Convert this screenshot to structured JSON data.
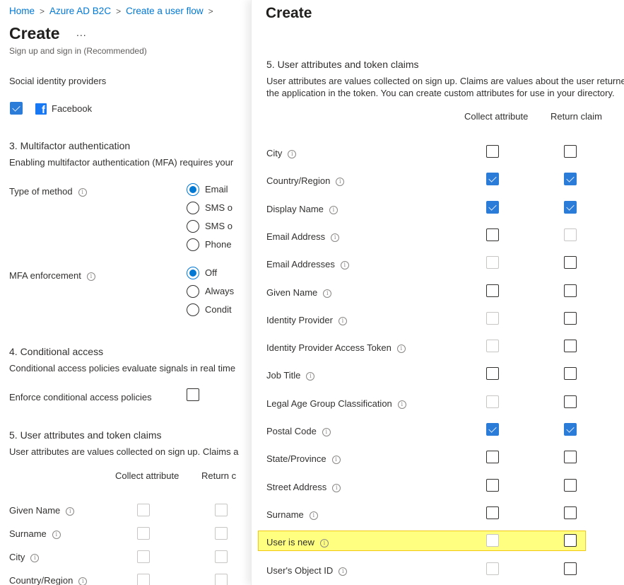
{
  "left": {
    "breadcrumb": [
      {
        "label": "Home"
      },
      {
        "label": "Azure AD B2C"
      },
      {
        "label": "Create a user flow"
      }
    ],
    "breadcrumb_separator": ">",
    "title": "Create",
    "more_label": "...",
    "subtitle": "Sign up and sign in (Recommended)",
    "social": {
      "title": "Social identity providers",
      "providers": [
        {
          "label": "Facebook",
          "checked": true
        }
      ]
    },
    "mfa": {
      "title": "3. Multifactor authentication",
      "description": "Enabling multifactor authentication (MFA) requires your",
      "type_label": "Type of method",
      "type_options": [
        {
          "label": "Email",
          "selected": true
        },
        {
          "label": "SMS o",
          "selected": false
        },
        {
          "label": "SMS o",
          "selected": false
        },
        {
          "label": "Phone",
          "selected": false
        }
      ],
      "enforcement_label": "MFA enforcement",
      "enforcement_options": [
        {
          "label": "Off",
          "selected": true
        },
        {
          "label": "Always",
          "selected": false
        },
        {
          "label": "Condit",
          "selected": false
        }
      ]
    },
    "conditional": {
      "title": "4. Conditional access",
      "description": "Conditional access policies evaluate signals in real time",
      "enforce_label": "Enforce conditional access policies",
      "enforce_checked": false
    },
    "attributes": {
      "title": "5. User attributes and token claims",
      "description": "User attributes are values collected on sign up. Claims a",
      "col_collect": "Collect attribute",
      "col_return": "Return c",
      "rows": [
        {
          "label": "Given Name",
          "collect": false,
          "return": false
        },
        {
          "label": "Surname",
          "collect": false,
          "return": false
        },
        {
          "label": "City",
          "collect": false,
          "return": false
        },
        {
          "label": "Country/Region",
          "collect": false,
          "return": false
        }
      ]
    }
  },
  "right": {
    "title": "Create",
    "attributes": {
      "title": "5. User attributes and token claims",
      "description_line1": "User attributes are values collected on sign up. Claims are values about the user returned",
      "description_line2": "the application in the token. You can create custom attributes for use in your directory.",
      "col_collect": "Collect attribute",
      "col_return": "Return claim",
      "rows": [
        {
          "label": "City",
          "collect": "unchecked",
          "return": "unchecked"
        },
        {
          "label": "Country/Region",
          "collect": "checked",
          "return": "checked"
        },
        {
          "label": "Display Name",
          "collect": "checked",
          "return": "checked"
        },
        {
          "label": "Email Address",
          "collect": "unchecked",
          "return": "disabled"
        },
        {
          "label": "Email Addresses",
          "collect": "disabled",
          "return": "unchecked"
        },
        {
          "label": "Given Name",
          "collect": "unchecked",
          "return": "unchecked"
        },
        {
          "label": "Identity Provider",
          "collect": "disabled",
          "return": "unchecked"
        },
        {
          "label": "Identity Provider Access Token",
          "collect": "disabled",
          "return": "unchecked"
        },
        {
          "label": "Job Title",
          "collect": "unchecked",
          "return": "unchecked"
        },
        {
          "label": "Legal Age Group Classification",
          "collect": "disabled",
          "return": "unchecked"
        },
        {
          "label": "Postal Code",
          "collect": "checked",
          "return": "checked"
        },
        {
          "label": "State/Province",
          "collect": "unchecked",
          "return": "unchecked"
        },
        {
          "label": "Street Address",
          "collect": "unchecked",
          "return": "unchecked"
        },
        {
          "label": "Surname",
          "collect": "unchecked",
          "return": "unchecked"
        },
        {
          "label": "User is new",
          "collect": "disabled",
          "return": "unchecked",
          "highlighted": true
        },
        {
          "label": "User's Object ID",
          "collect": "disabled",
          "return": "unchecked"
        }
      ]
    },
    "highlight_color": "#ffff80"
  }
}
